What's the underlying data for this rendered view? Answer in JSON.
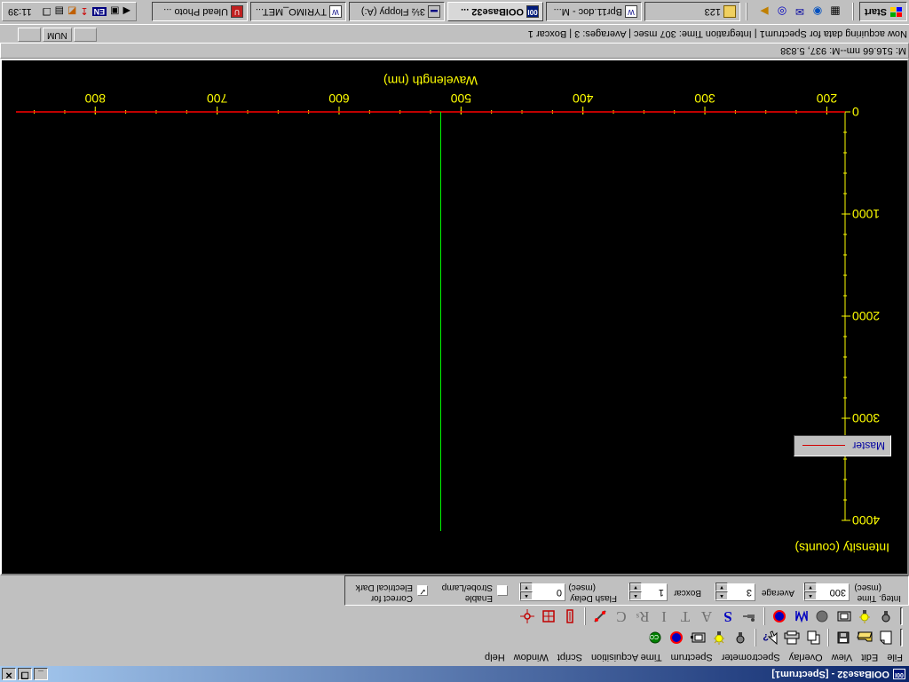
{
  "window": {
    "title": "OOIBase32 - [Spectrum1]",
    "app_icon": "00I"
  },
  "menu": [
    "File",
    "Edit",
    "View",
    "Overlay",
    "Spectrometer",
    "Spectrum",
    "Time Acquisition",
    "Script",
    "Window",
    "Help"
  ],
  "toolbar2_letters": [
    "S",
    "A",
    "T",
    "I",
    "R",
    "C"
  ],
  "toolbar2_r_sub": "s",
  "controls": {
    "integ_time_label": "Integ. Time",
    "integ_time_unit": "(msec)",
    "integ_time_value": "300",
    "average_label": "Average",
    "average_value": "3",
    "boxcar_label": "Boxcar",
    "boxcar_value": "1",
    "flash_delay_label": "Flash Delay",
    "flash_delay_unit": "(msec)",
    "flash_delay_value": "0",
    "strobe_label_1": "Enable",
    "strobe_label_2": "Strobe/Lamp",
    "strobe_checked": false,
    "correct_label_1": "Correct for",
    "correct_label_2": "Electrical Dark",
    "correct_checked": true
  },
  "chart_data": {
    "type": "line",
    "title": "",
    "xlabel": "Wavelength (nm)",
    "ylabel": "Intensity (counts)",
    "xlim": [
      185,
      865
    ],
    "ylim": [
      0,
      4000
    ],
    "x_ticks": [
      200,
      300,
      400,
      500,
      600,
      700,
      800
    ],
    "y_ticks": [
      0,
      1000,
      2000,
      3000,
      4000
    ],
    "grid": false,
    "legend_position": "top-right",
    "colors": {
      "background": "#000000",
      "axes": "#ffff00",
      "series": "#ff0000",
      "cursor": "#00ff00"
    },
    "series": [
      {
        "name": "Master",
        "x": [
          185,
          865
        ],
        "y": [
          0,
          0
        ]
      }
    ],
    "cursor_x": 516.66
  },
  "status": {
    "cursor_readout": "M: 516.66 nm--M: 937, 5.838",
    "acquiring": "Now acquiring data for Spectrum1 | Integration Time: 307 msec | Averages: 3 | Boxcar 1",
    "num": "NUM"
  },
  "taskbar": {
    "start": "Start",
    "tasks": [
      {
        "label": "123",
        "icon": "folder-icon",
        "active": false
      },
      {
        "label": "Bpr11.doc - M...",
        "icon": "word-icon",
        "active": false
      },
      {
        "label": "OOIBase32 ...",
        "icon": "ooi-icon",
        "active": true
      },
      {
        "label": "3½ Floppy (A:)",
        "icon": "floppy-icon",
        "active": false
      },
      {
        "label": "TYRIMO_MET...",
        "icon": "word-icon",
        "active": false
      },
      {
        "label": "Ulead Photo ...",
        "icon": "ulead-icon",
        "active": false
      }
    ],
    "tray_lang": "EN",
    "clock": "11:39"
  }
}
